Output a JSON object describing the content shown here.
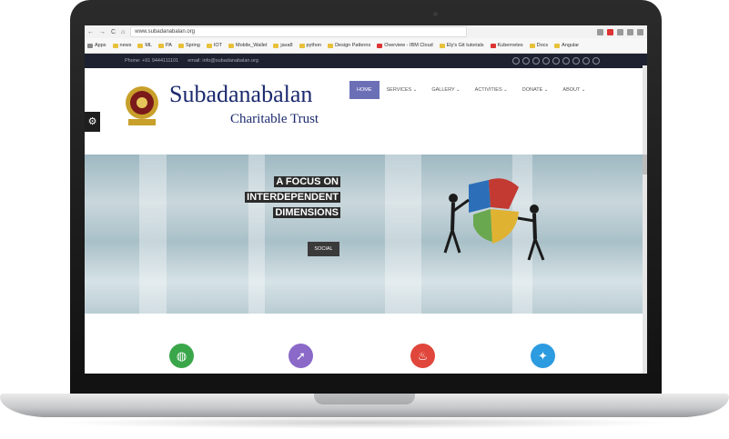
{
  "browser": {
    "url": "www.subadanabalan.org",
    "bookmarks": [
      "Apps",
      "news",
      "ML",
      "PA",
      "Spring",
      "IOT",
      "Mobile_Wallet",
      "java8",
      "python",
      "Design Patterns",
      "Overview - IBM Cloud",
      "Ely's Git tutorials",
      "Kubernetes",
      "Docs",
      "Angular"
    ]
  },
  "topbar": {
    "phone": "Phone: +91 9444111101",
    "email": "email: info@subadanabalan.org"
  },
  "brand": {
    "name": "Subadanabalan",
    "sub": "Charitable Trust"
  },
  "nav": [
    "HOME",
    "SERVICES ⌄",
    "GALLERY ⌄",
    "ACTIVITIES ⌄",
    "DONATE ⌄",
    "ABOUT ⌄"
  ],
  "hero": {
    "line1": "A FOCUS ON",
    "line2": "INTERDEPENDENT",
    "line3": "DIMENSIONS",
    "button": "SOCIAL"
  },
  "colors": {
    "nav_active": "#6b70b6",
    "feature_green": "#3aa64a",
    "feature_purple": "#8a69c8",
    "feature_red": "#e0463b",
    "feature_blue": "#2d9be0"
  },
  "icons": [
    "globe-icon",
    "rocket-icon",
    "fire-icon",
    "twitter-icon"
  ]
}
